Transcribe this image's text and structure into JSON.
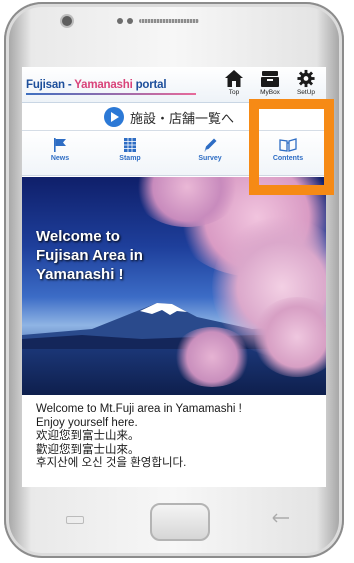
{
  "header": {
    "logo_part1": "Fujisan - ",
    "logo_part2": "Yamanashi",
    "logo_part3": " portal",
    "buttons": [
      {
        "label": "Top",
        "icon": "home-icon"
      },
      {
        "label": "MyBox",
        "icon": "box-icon"
      },
      {
        "label": "SetUp",
        "icon": "gear-icon"
      }
    ]
  },
  "banner": {
    "text": "施設・店舗一覧へ"
  },
  "tabs": [
    {
      "label": "News",
      "icon": "flag-icon"
    },
    {
      "label": "Stamp",
      "icon": "stamp-grid-icon"
    },
    {
      "label": "Survey",
      "icon": "pencil-icon"
    },
    {
      "label": "Contents",
      "icon": "book-icon"
    }
  ],
  "hero": {
    "welcome_lines": [
      "Welcome to",
      "Fujisan Area in",
      "Yamanashi !"
    ]
  },
  "body_text": [
    "Welcome to Mt.Fuji area in Yamamashi !",
    "Enjoy yourself here.",
    "欢迎您到富士山来。",
    "歡迎您到富士山來。",
    "후지산에 오신 것을 환영합니다."
  ],
  "colors": {
    "accent_blue": "#2e6dc4",
    "logo_pink": "#d9437a",
    "highlight_orange": "#f68a15"
  }
}
